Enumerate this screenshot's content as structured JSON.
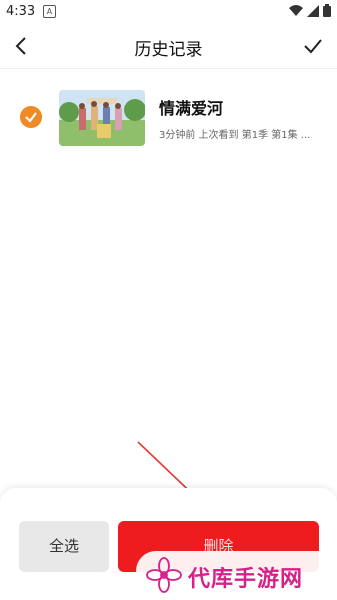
{
  "status": {
    "time": "4:33",
    "notif": "A"
  },
  "header": {
    "title": "历史记录"
  },
  "history": [
    {
      "title": "情满爱河",
      "meta": "3分钟前  上次看到  第1季  第1集 ..."
    }
  ],
  "footer": {
    "select_all": "全选",
    "delete": "删除"
  },
  "watermark": {
    "text": "代库手游网"
  },
  "colors": {
    "accent": "#f08a24",
    "delete": "#ee1c1f",
    "watermark": "#d6218b"
  }
}
